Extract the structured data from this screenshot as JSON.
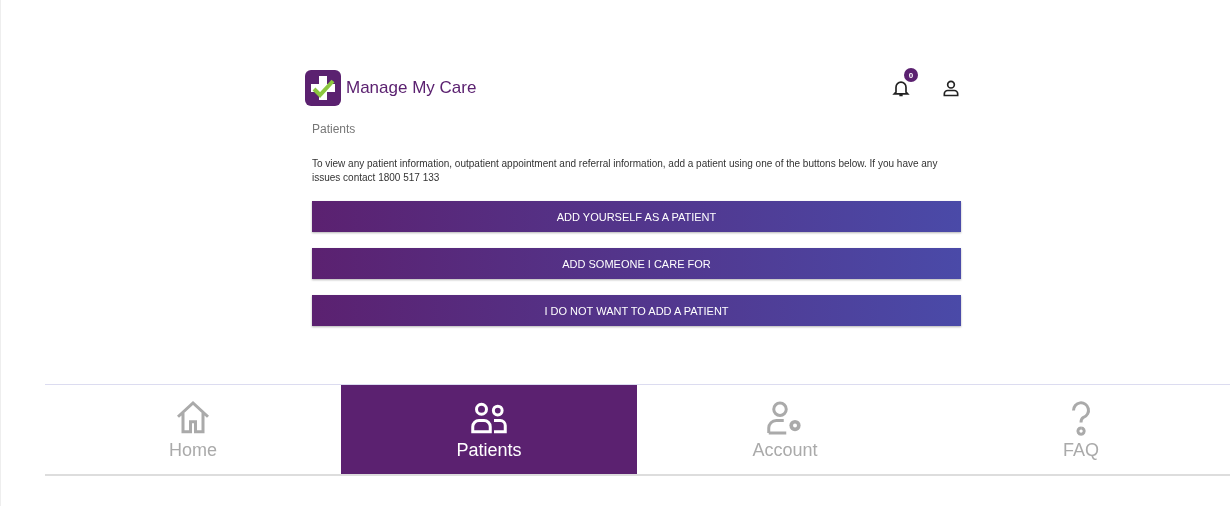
{
  "header": {
    "app_name": "Manage My Care",
    "notification_count": "0"
  },
  "page_title": "Patients",
  "intro": "To view any patient information, outpatient appointment and referral information, add a patient using one of the buttons below. If you have any issues contact 1800 517 133",
  "buttons": [
    "ADD YOURSELF AS A PATIENT",
    "ADD SOMEONE I CARE FOR",
    "I DO NOT WANT TO ADD A PATIENT"
  ],
  "nav": [
    {
      "label": "Home",
      "kind": "home",
      "selected": false
    },
    {
      "label": "Patients",
      "kind": "patients",
      "selected": true
    },
    {
      "label": "Account",
      "kind": "account",
      "selected": false
    },
    {
      "label": "FAQ",
      "kind": "faq",
      "selected": false
    }
  ]
}
